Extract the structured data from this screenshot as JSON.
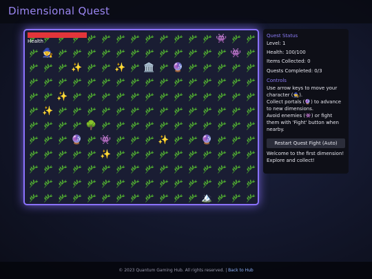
{
  "header": {
    "title": "Dimensional Quest"
  },
  "board": {
    "health_label": "Health",
    "health_fraction": 1.0,
    "terrain_icon": "leaf-icon",
    "entities": [
      {
        "icon": "🧙",
        "name": "player-character",
        "row": 1,
        "col": 1
      },
      {
        "icon": "👾",
        "name": "enemy",
        "row": 0,
        "col": 13
      },
      {
        "icon": "👾",
        "name": "enemy",
        "row": 1,
        "col": 14
      },
      {
        "icon": "👾",
        "name": "enemy",
        "row": 7,
        "col": 5
      },
      {
        "icon": "✨",
        "name": "sparkle-item",
        "row": 2,
        "col": 3
      },
      {
        "icon": "✨",
        "name": "sparkle-item",
        "row": 2,
        "col": 6
      },
      {
        "icon": "✨",
        "name": "sparkle-item",
        "row": 4,
        "col": 2
      },
      {
        "icon": "✨",
        "name": "sparkle-item",
        "row": 5,
        "col": 1
      },
      {
        "icon": "✨",
        "name": "sparkle-item",
        "row": 8,
        "col": 5
      },
      {
        "icon": "✨",
        "name": "sparkle-item",
        "row": 7,
        "col": 9
      },
      {
        "icon": "🏛️",
        "name": "temple",
        "row": 2,
        "col": 8
      },
      {
        "icon": "🔮",
        "name": "portal",
        "row": 2,
        "col": 10
      },
      {
        "icon": "🔮",
        "name": "portal",
        "row": 7,
        "col": 3
      },
      {
        "icon": "🔮",
        "name": "portal",
        "row": 7,
        "col": 12
      },
      {
        "icon": "🌳",
        "name": "tree",
        "row": 6,
        "col": 4
      },
      {
        "icon": "🏔️",
        "name": "mountain",
        "row": 11,
        "col": 12
      }
    ]
  },
  "status": {
    "heading": "Quest Status",
    "level": "Level: 1",
    "health": "Health: 100/100",
    "items": "Items Collected: 0",
    "quests": "Quests Completed: 0/3"
  },
  "controls": {
    "heading": "Controls",
    "line1": "Use arrow keys to move your character (🧙).",
    "line2": "Collect portals (🔮) to advance to new dimensions.",
    "line3": "Avoid enemies (👾) or fight them with 'Fight' button when nearby.",
    "button_label": "Restart Quest Fight (Auto)",
    "message": "Welcome to the first dimension! Explore and collect!"
  },
  "footer": {
    "copyright": "© 2023 Quantum Gaming Hub. All rights reserved. |",
    "link": "Back to Hub"
  },
  "colors": {
    "accent": "#8b72ff",
    "health": "#e2353a",
    "link": "#8fb4ff"
  }
}
